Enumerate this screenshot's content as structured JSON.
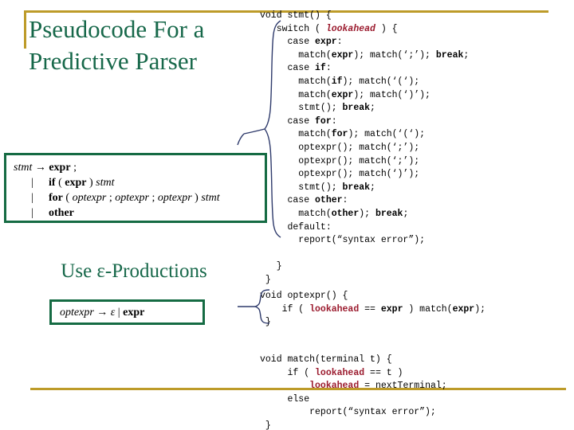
{
  "slide": {
    "title": "Pseudocode For a Predictive Parser",
    "title_lines": [
      "Pseudocode For a",
      "Predictive Parser"
    ],
    "eps_heading": "Use ε-Productions",
    "accent_gold": "#BD9B29",
    "accent_green": "#156B43",
    "title_green": "#17684A",
    "keyword_red": "#9B1B2E"
  },
  "grammar_stmt": {
    "lhs": "stmt",
    "arrow": "→",
    "alternatives": [
      {
        "bar": "",
        "text_html": "<span class=\"t\">expr</span> ;"
      },
      {
        "bar": "|",
        "text_html": "<span class=\"t\">if</span> ( <span class=\"t\">expr</span> ) <span class=\"nt\">stmt</span>"
      },
      {
        "bar": "|",
        "text_html": "<span class=\"t\">for</span> ( <span class=\"nt\">optexpr</span> ; <span class=\"nt\">optexpr</span> ; <span class=\"nt\">optexpr</span>  ) <span class=\"nt\">stmt</span>"
      },
      {
        "bar": "|",
        "text_html": "<span class=\"t\">other</span>"
      }
    ],
    "plain_text": [
      "stmt → expr ;",
      "     | if ( expr ) stmt",
      "     | for ( optexpr ; optexpr ; optexpr ) stmt",
      "     | other"
    ]
  },
  "grammar_optexpr": {
    "lhs": "optexpr",
    "arrow": "→",
    "text_html": "<span class=\"nt\">optexpr</span>  <span class=\"arrow\">→</span> <span class=\"eps\">ε</span>  |  <span class=\"t\">expr</span>",
    "plain_text": "optexpr → ε | expr"
  },
  "code_stmt": {
    "name": "stmt-function",
    "html": "void stmt() {\n   switch ( <span class=\"look\">lookahead</span> ) {\n     case <span class=\"kw\">expr</span>:\n       match(<span class=\"kw\">expr</span>); match(‘;’); <span class=\"kw\">break</span>;\n     case <span class=\"kw\">if</span>:\n       match(<span class=\"kw\">if</span>); match(‘(‘);\n       match(<span class=\"kw\">expr</span>); match(‘)’);\n       stmt(); <span class=\"kw\">break</span>;\n     case <span class=\"kw\">for</span>:\n       match(<span class=\"kw\">for</span>); match(‘(‘);\n       optexpr(); match(‘;’);\n       optexpr(); match(‘;’);\n       optexpr(); match(‘)’);\n       stmt(); <span class=\"kw\">break</span>;\n     case <span class=\"kw\">other</span>:\n       match(<span class=\"kw\">other</span>); <span class=\"kw\">break</span>;\n     default:\n       report(“syntax error”);\n\n   }\n }",
    "plain_text": "void stmt() {\n   switch ( lookahead ) {\n     case expr:\n       match(expr); match(';'); break;\n     case if:\n       match(if); match('(');\n       match(expr); match(')');\n       stmt(); break;\n     case for:\n       match(for); match('(');\n       optexpr(); match(';');\n       optexpr(); match(';');\n       optexpr(); match(')');\n       stmt(); break;\n     case other:\n       match(other); break;\n     default:\n       report(\"syntax error\");\n\n   }\n }"
  },
  "code_optexpr": {
    "name": "optexpr-function",
    "html": "void optexpr() {\n    if ( <span class=\"look-up\">lookahead</span> == <span class=\"kw\">expr</span> ) match(<span class=\"kw\">expr</span>);\n }",
    "plain_text": "void optexpr() {\n    if ( lookahead == expr ) match(expr);\n }"
  },
  "code_match": {
    "name": "match-function",
    "html": "void match(terminal t) {\n     if ( <span class=\"look-up\">lookahead</span> == t )\n         <span class=\"look-up\">lookahead</span> = nextTerminal;\n     else\n         report(“syntax error”);\n }",
    "plain_text": "void match(terminal t) {\n     if ( lookahead == t )\n         lookahead = nextTerminal;\n     else\n         report(\"syntax error\");\n }"
  },
  "braces": {
    "stmt_brace_label": "switch-body-brace",
    "optexpr_brace_label": "optexpr-body-brace",
    "color": "#2E3A6B"
  }
}
